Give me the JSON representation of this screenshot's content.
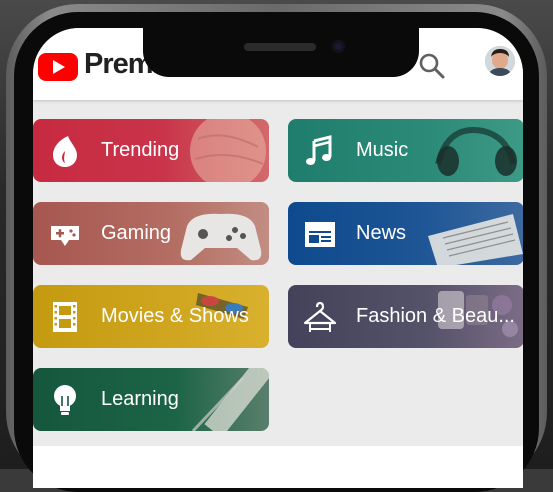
{
  "app": {
    "logo_text": "Premium"
  },
  "header": {
    "search_icon": "search-icon",
    "avatar": "user-avatar"
  },
  "colors": {
    "brand_red": "#ff0000",
    "trending": "#c0283f",
    "music": "#1f7d6d",
    "gaming": "#a85b57",
    "news": "#0e4a8d",
    "movies": "#c69a11",
    "fashion": "#47465a",
    "learning": "#155d40"
  },
  "categories": [
    {
      "label": "Trending",
      "icon": "trending-flame-icon"
    },
    {
      "label": "Music",
      "icon": "music-note-icon"
    },
    {
      "label": "Gaming",
      "icon": "gamepad-icon"
    },
    {
      "label": "News",
      "icon": "newspaper-icon"
    },
    {
      "label": "Movies & Shows",
      "icon": "film-strip-icon"
    },
    {
      "label": "Fashion & Beau...",
      "icon": "clothes-hanger-icon"
    },
    {
      "label": "Learning",
      "icon": "lightbulb-icon"
    }
  ]
}
